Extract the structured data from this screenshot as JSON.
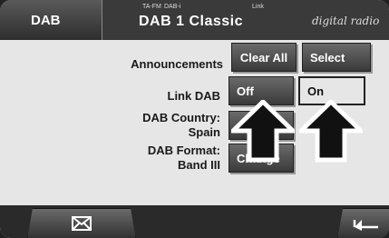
{
  "header": {
    "section": "DAB",
    "status_ta_fm": "TA-FM",
    "status_dab_i": "DAB-i",
    "status_link": "Link",
    "station": "DAB 1  Classic",
    "logo": "digital radio"
  },
  "rows": {
    "announcements": {
      "label": "Announcements",
      "clear_all": "Clear All",
      "select": "Select"
    },
    "link_dab": {
      "label": "Link DAB",
      "off": "Off",
      "on": "On"
    },
    "country": {
      "label_line1": "DAB Country:",
      "label_line2": "Spain"
    },
    "format": {
      "label_line1": "DAB Format:",
      "label_line2": "Band III",
      "change": "Change"
    }
  },
  "footer": {
    "left_icon": "envelope-icon",
    "right_icon": "return-arrow-icon"
  }
}
